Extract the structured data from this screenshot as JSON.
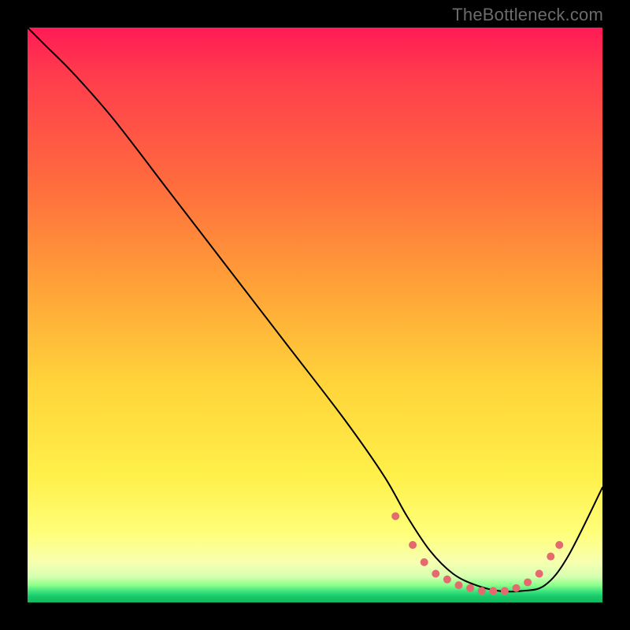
{
  "watermark": "TheBottleneck.com",
  "chart_data": {
    "type": "line",
    "title": "",
    "xlabel": "",
    "ylabel": "",
    "xlim": [
      0,
      100
    ],
    "ylim": [
      0,
      100
    ],
    "grid": false,
    "legend": false,
    "series": [
      {
        "name": "curve",
        "x": [
          0,
          3,
          8,
          15,
          25,
          35,
          45,
          55,
          62,
          66,
          70,
          74,
          78,
          82,
          86,
          90,
          94,
          100
        ],
        "y": [
          100,
          97,
          92,
          84,
          71,
          58,
          45,
          32,
          22,
          15,
          9,
          5,
          3,
          2,
          2,
          3,
          8,
          20
        ],
        "stroke": "#000000",
        "width": 2.0
      }
    ],
    "markers": {
      "name": "dots",
      "color": "#e46a6f",
      "radius": 5,
      "points": [
        {
          "x": 64,
          "y": 15
        },
        {
          "x": 67,
          "y": 10
        },
        {
          "x": 69,
          "y": 7
        },
        {
          "x": 71,
          "y": 5
        },
        {
          "x": 73,
          "y": 4
        },
        {
          "x": 75,
          "y": 3
        },
        {
          "x": 77,
          "y": 2.5
        },
        {
          "x": 79,
          "y": 2
        },
        {
          "x": 81,
          "y": 2
        },
        {
          "x": 83,
          "y": 2
        },
        {
          "x": 85,
          "y": 2.5
        },
        {
          "x": 87,
          "y": 3.5
        },
        {
          "x": 89,
          "y": 5
        },
        {
          "x": 91,
          "y": 8
        },
        {
          "x": 92.5,
          "y": 10
        }
      ]
    }
  }
}
